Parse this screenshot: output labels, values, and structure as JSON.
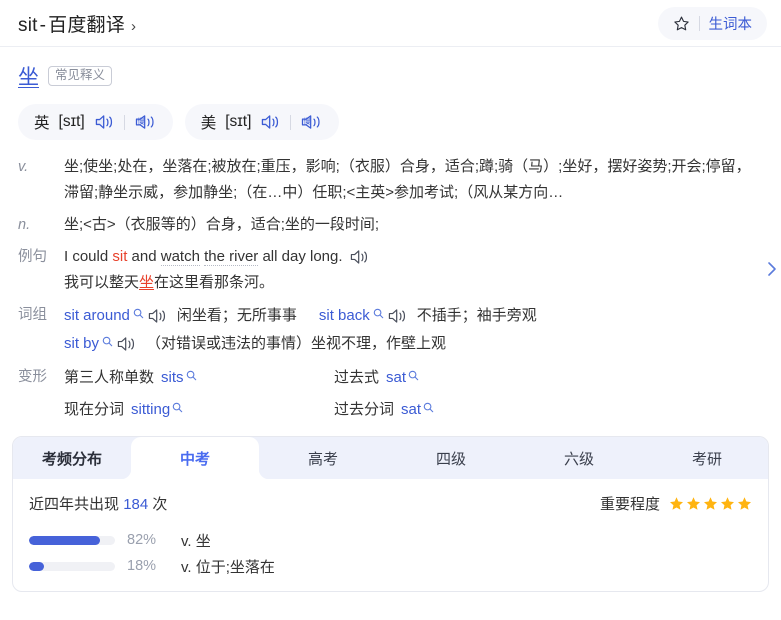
{
  "header": {
    "title_en": "sit",
    "title_sep": "-",
    "title_cn": "百度翻译",
    "chevron": "›",
    "wordbook_label": "生词本",
    "star_icon": "star-outline-icon"
  },
  "headword": {
    "word": "坐",
    "tag": "常见释义"
  },
  "phonetics": [
    {
      "region": "英",
      "ipa": "[sɪt]",
      "speaker_icon": "speaker-icon",
      "slow_icon": "slow-speaker-icon"
    },
    {
      "region": "美",
      "ipa": "[sɪt]",
      "speaker_icon": "speaker-icon",
      "slow_icon": "slow-speaker-icon"
    }
  ],
  "definitions": [
    {
      "pos": "v.",
      "text": "坐;使坐;处在，坐落在;被放在;重压，影响;（衣服）合身，适合;蹲;骑（马）;坐好，摆好姿势;开会;停留，滞留;静坐示威，参加静坐;（在…中）任职;<主英>参加考试;（风从某方向…"
    },
    {
      "pos": "n.",
      "text": "坐;<古>（衣服等的）合身，适合;坐的一段时间;"
    }
  ],
  "example": {
    "label": "例句",
    "en_parts": [
      {
        "t": "I could ",
        "style": "plain"
      },
      {
        "t": "sit",
        "style": "keyword"
      },
      {
        "t": " and ",
        "style": "plain"
      },
      {
        "t": "watch",
        "style": "dotted"
      },
      {
        "t": " ",
        "style": "plain"
      },
      {
        "t": "the river",
        "style": "dotted"
      },
      {
        "t": " all day long.",
        "style": "plain"
      }
    ],
    "en_plain": "I could sit and watch the river all day long.",
    "zh_before": "我可以整天",
    "zh_keyword": "坐",
    "zh_after": "在这里看那条河。",
    "speaker_icon": "speaker-icon",
    "expand_icon": "chevron-right-icon"
  },
  "phrases": {
    "label": "词组",
    "items": [
      {
        "term": "sit around",
        "meaning": "闲坐看；无所事事",
        "search_icon": "search-icon",
        "speaker_icon": "speaker-icon"
      },
      {
        "term": "sit back",
        "meaning": "不插手；袖手旁观",
        "search_icon": "search-icon",
        "speaker_icon": "speaker-icon"
      },
      {
        "term": "sit by",
        "meaning": "（对错误或违法的事情）坐视不理，作壁上观",
        "search_icon": "search-icon",
        "speaker_icon": "speaker-icon"
      }
    ]
  },
  "forms": {
    "label": "变形",
    "items": [
      {
        "name": "第三人称单数",
        "value": "sits",
        "search_icon": "search-icon"
      },
      {
        "name": "过去式",
        "value": "sat",
        "search_icon": "search-icon"
      },
      {
        "name": "现在分词",
        "value": "sitting",
        "search_icon": "search-icon"
      },
      {
        "name": "过去分词",
        "value": "sat",
        "search_icon": "search-icon"
      }
    ]
  },
  "frequency": {
    "section_title": "考频分布",
    "tabs": [
      {
        "label": "中考",
        "active": true
      },
      {
        "label": "高考",
        "active": false
      },
      {
        "label": "四级",
        "active": false
      },
      {
        "label": "六级",
        "active": false
      },
      {
        "label": "考研",
        "active": false
      }
    ],
    "count_prefix": "近四年共出现",
    "count_value": "184",
    "count_suffix": "次",
    "importance_label": "重要程度",
    "stars_filled": 5,
    "star_color": "#ffb411",
    "accent_color": "#4662d9"
  },
  "chart_data": {
    "type": "bar",
    "title": "考频分布 - 中考",
    "orientation": "horizontal",
    "categories": [
      "v. 坐",
      "v. 位于;坐落在"
    ],
    "values": [
      82,
      18
    ],
    "value_labels": [
      "82%",
      "18%"
    ],
    "unit": "%",
    "xlim": [
      0,
      100
    ],
    "grid": false,
    "legend": "none",
    "bar_color": "#4662d9",
    "track_color": "#f0f1f5"
  }
}
